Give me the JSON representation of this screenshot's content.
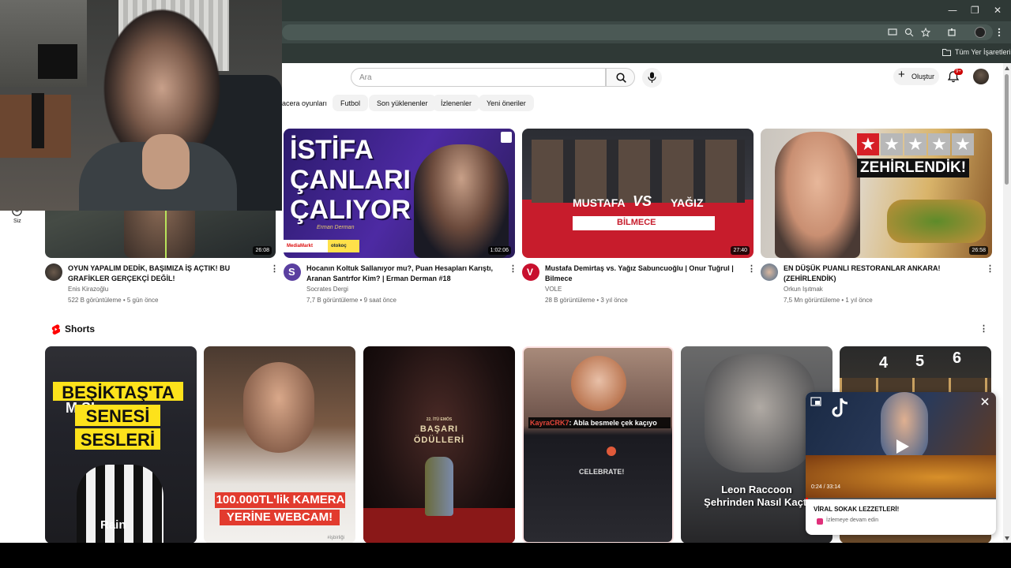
{
  "browser": {
    "window_controls": [
      "—",
      "❐",
      "✕"
    ],
    "bookmarks_label": "Tüm Yer İşaretleri",
    "toolbar_icons": [
      "cast-icon",
      "zoom-icon",
      "star-icon",
      "extensions-icon",
      "profile-icon",
      "menu-icon"
    ]
  },
  "header": {
    "search_placeholder": "Ara",
    "create_label": "Oluştur",
    "notification_badge": "9+"
  },
  "chips": [
    "acera oyunları",
    "Futbol",
    "Son yüklenenler",
    "İzlenenler",
    "Yeni öneriler"
  ],
  "sidebar": {
    "you_label": "Siz"
  },
  "videos": [
    {
      "title": "OYUN YAPALIM DEDİK, BAŞIMIZA İŞ AÇTIK! BU GRAFİKLER GERÇEKÇİ DEĞİL!",
      "channel": "Enis Kirazoğlu",
      "meta": "522 B görüntüleme • 5 gün önce",
      "duration": "26:08"
    },
    {
      "title": "Hocanın Koltuk Sallanıyor mu?, Puan Hesapları Karıştı, Aranan Santrfor Kim? | Erman Derman #18",
      "channel": "Socrates Dergi",
      "meta": "7,7 B görüntüleme • 9 saat önce",
      "duration": "1:02:06",
      "thumb_text": [
        "İSTİFA",
        "ÇANLARI",
        "ÇALIYOR"
      ],
      "thumb_sign": "Erman Derman",
      "thumb_logo1": "MediaMarkt",
      "thumb_logo2": "otokoç"
    },
    {
      "title": "Mustafa Demirtaş vs. Yağız Sabuncuoğlu | Onur Tuğrul | Bilmece",
      "channel": "VOLE",
      "meta": "28 B görüntüleme • 3 yıl önce",
      "duration": "27:40",
      "thumb_text": [
        "MUSTAFA",
        "VS",
        "YAĞIZ"
      ],
      "thumb_sub": "BİLMECE"
    },
    {
      "title": "EN DÜŞÜK PUANLI RESTORANLAR ANKARA! (ZEHİRLENDİK)",
      "channel": "Orkun Işıtmak",
      "meta": "7,5 Mn görüntüleme • 1 yıl önce",
      "duration": "26:58",
      "thumb_text": "ZEHİRLENDİK!",
      "thumb_rating": 1,
      "thumb_rating_max": 5
    }
  ],
  "shorts": {
    "heading": "Shorts",
    "items": [
      {
        "overlay": [
          "BEŞİKTAŞ'TA",
          "SENESİ",
          "SESLERİ"
        ],
        "partial": "M        SI",
        "brand": "Rain"
      },
      {
        "overlay": [
          "100.000TL'lik KAMERA",
          "YERİNE WEBCAM!"
        ],
        "tag": "#işbirliği"
      },
      {
        "overlay": [
          "BAŞARI",
          "ÖDÜLLERİ"
        ],
        "small": "22. İTÜ EMÖS"
      },
      {
        "caption_user": "KayraCRK7",
        "caption": ": Abla besmele çek kaçıyo",
        "sign": "CELEBRATE!"
      },
      {
        "overlay": [
          "Leon Raccoon",
          "Şehrinden Nasıl Kaçtı"
        ]
      },
      {
        "overlay": [
          "4",
          "5",
          "6"
        ]
      }
    ]
  },
  "miniplayer": {
    "time": "0:24 / 33:14",
    "title": "VİRAL SOKAK LEZZETLERİ!",
    "status": "İzlemeye devam edin"
  }
}
